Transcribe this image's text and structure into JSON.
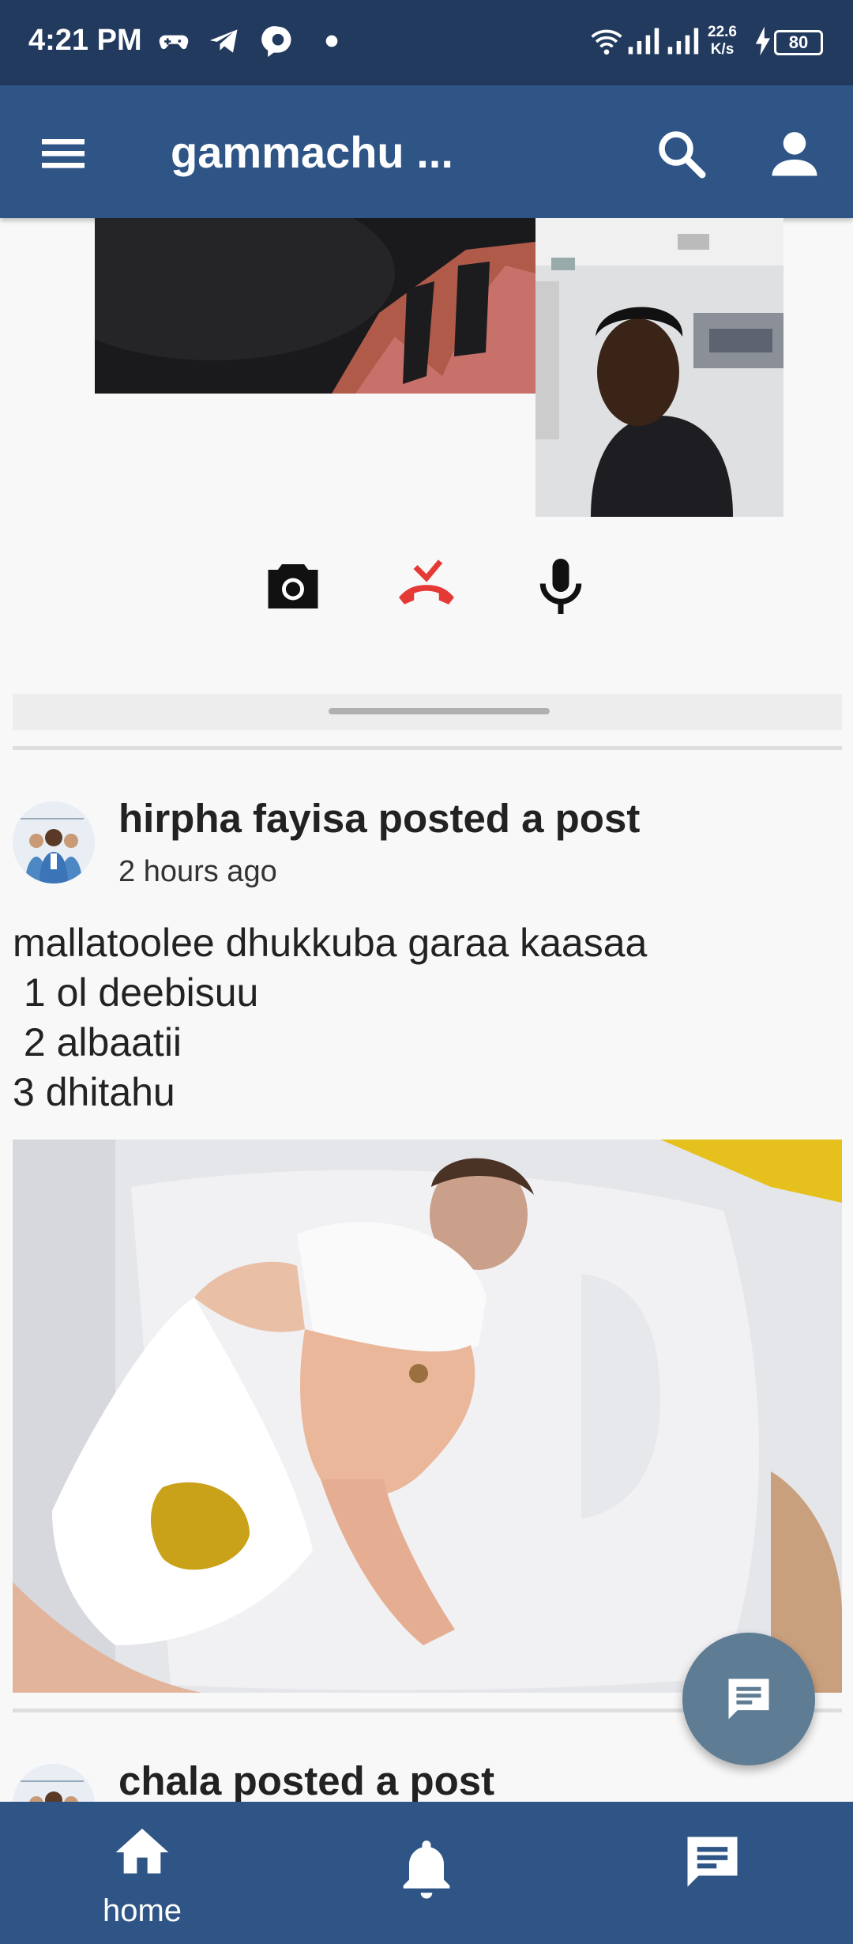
{
  "status_bar": {
    "time": "4:21 PM",
    "network_speed_value": "22.6",
    "network_speed_unit": "K/s",
    "battery": "80",
    "icons": [
      "gamepad-icon",
      "telegram-icon",
      "chat-app-icon",
      "dot-icon",
      "wifi-icon",
      "signal-icon",
      "signal-icon",
      "charging-icon"
    ]
  },
  "app_bar": {
    "title": "gammachu ...",
    "icons": [
      "menu-icon",
      "search-icon",
      "account-icon"
    ]
  },
  "call": {
    "controls": [
      "camera-icon",
      "end-call-icon",
      "microphone-icon"
    ],
    "end_call_color": "#e53935"
  },
  "posts": [
    {
      "author_line": "hirpha fayisa posted a post",
      "time": "2 hours ago",
      "body_lines": [
        "mallatoolee dhukkuba garaa kaasaa",
        " 1 ol deebisuu",
        " 2 albaatii",
        "3 dhitahu"
      ]
    },
    {
      "author_line": "chala posted a post"
    }
  ],
  "fab": {
    "icon": "message-icon"
  },
  "bottom_nav": {
    "items": [
      {
        "icon": "home-icon",
        "label": "home"
      },
      {
        "icon": "bell-icon"
      },
      {
        "icon": "message-icon"
      }
    ]
  },
  "colors": {
    "status_bar": "#223a5e",
    "app_bar": "#2e5586",
    "fab": "#5e7c93",
    "background": "#f8f8f8"
  }
}
